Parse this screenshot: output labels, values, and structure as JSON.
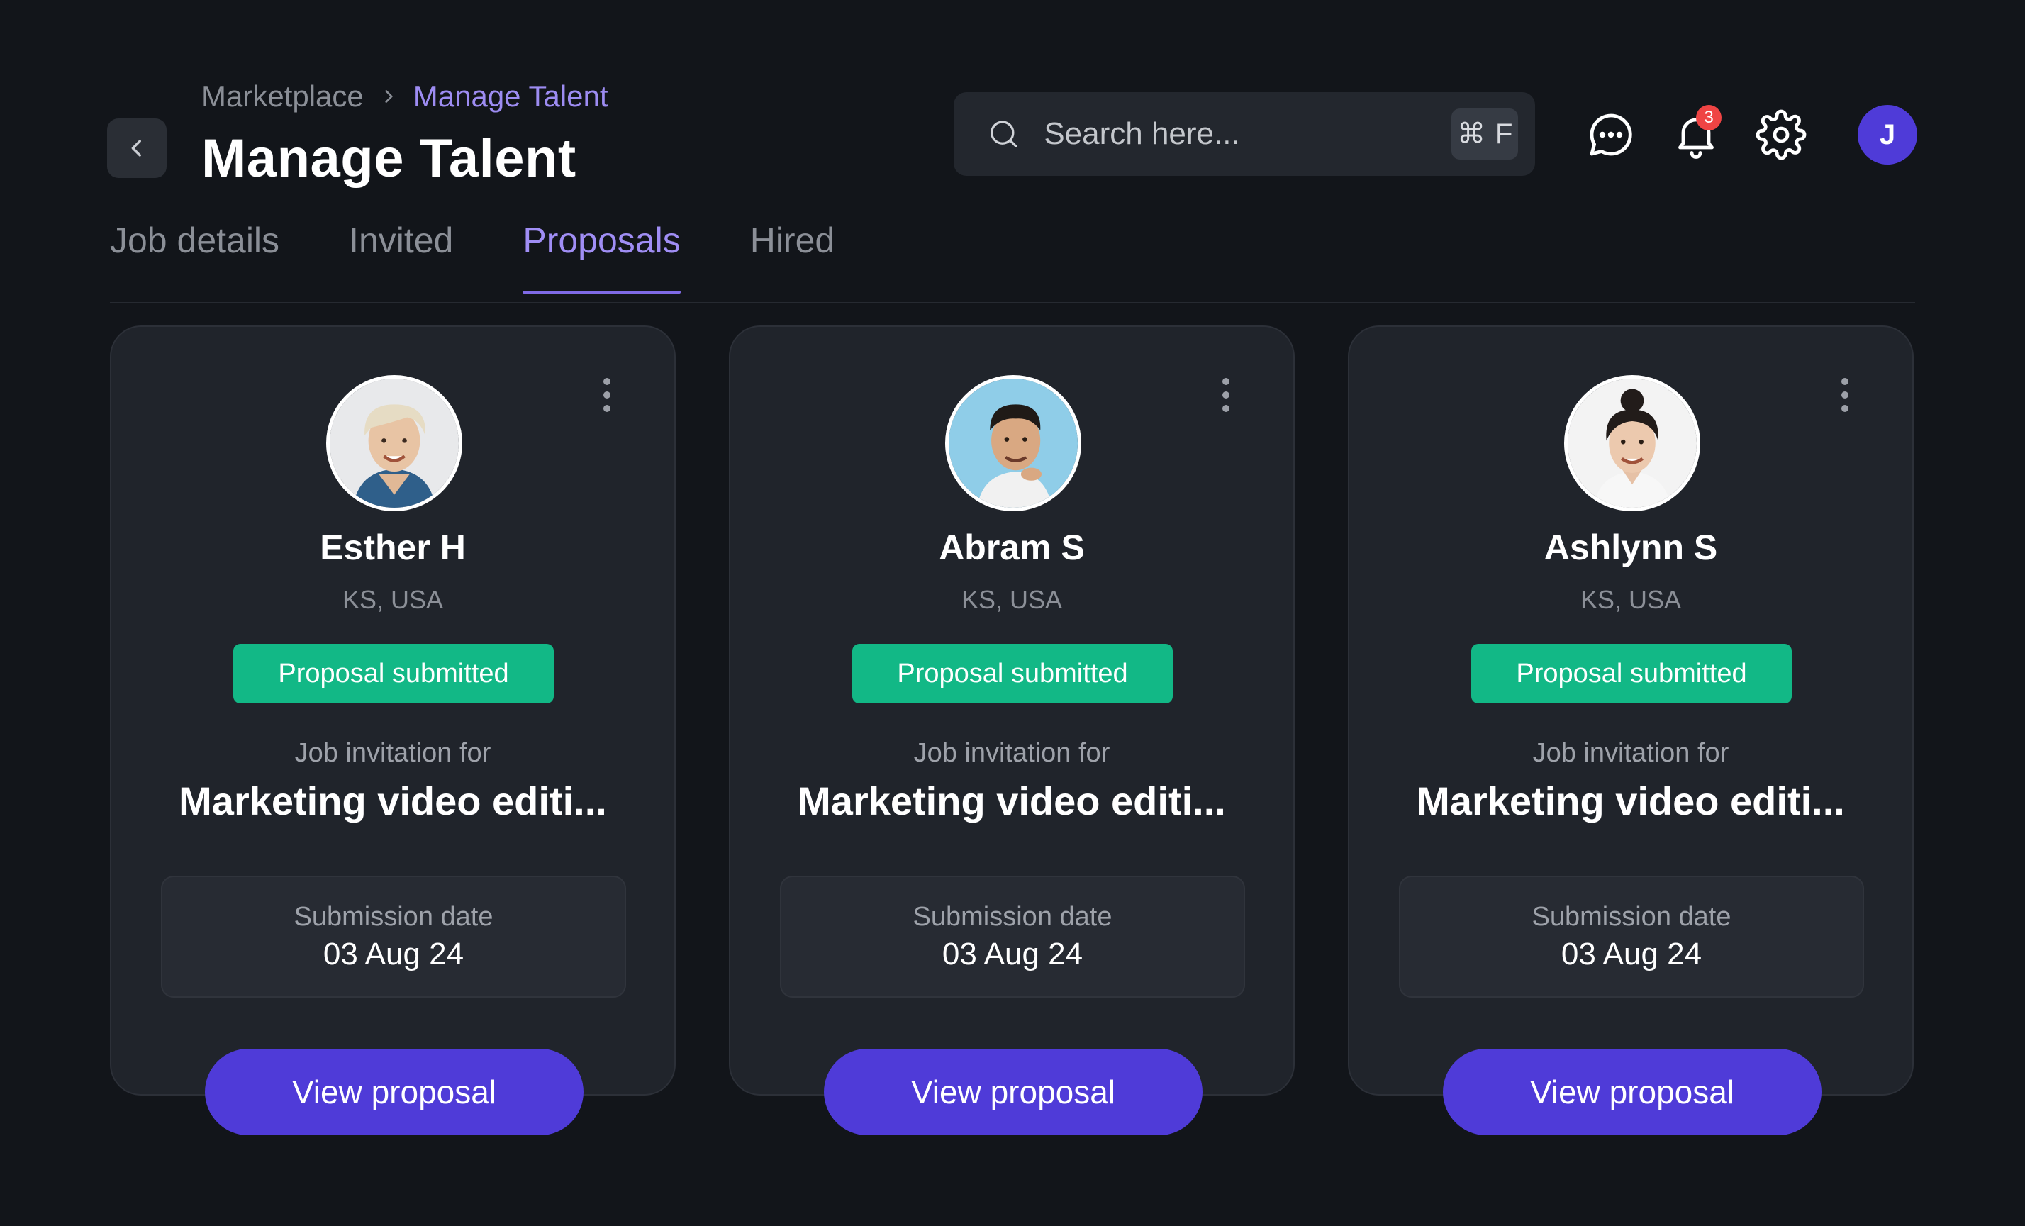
{
  "breadcrumb": {
    "parent": "Marketplace",
    "current": "Manage Talent"
  },
  "page_title": "Manage Talent",
  "search": {
    "placeholder": "Search here...",
    "shortcut_symbol": "⌘",
    "shortcut_key": "F"
  },
  "notifications": {
    "count": "3"
  },
  "user": {
    "initial": "J"
  },
  "tabs": [
    {
      "label": "Job details",
      "active": false
    },
    {
      "label": "Invited",
      "active": false
    },
    {
      "label": "Proposals",
      "active": true
    },
    {
      "label": "Hired",
      "active": false
    }
  ],
  "cards": [
    {
      "name": "Esther H",
      "location": "KS, USA",
      "status": "Proposal submitted",
      "invite_label": "Job invitation for",
      "job_title": "Marketing video editi...",
      "date_label": "Submission date",
      "date_value": "03 Aug 24",
      "button": "View proposal"
    },
    {
      "name": "Abram S",
      "location": "KS, USA",
      "status": "Proposal submitted",
      "invite_label": "Job invitation for",
      "job_title": "Marketing video editi...",
      "date_label": "Submission date",
      "date_value": "03 Aug 24",
      "button": "View proposal"
    },
    {
      "name": "Ashlynn S",
      "location": "KS, USA",
      "status": "Proposal submitted",
      "invite_label": "Job invitation for",
      "job_title": "Marketing video editi...",
      "date_label": "Submission date",
      "date_value": "03 Aug 24",
      "button": "View proposal"
    }
  ],
  "colors": {
    "background": "#12151a",
    "card": "#20242b",
    "accent": "#4f3bd8",
    "active_tab": "#a08ef5",
    "status_green": "#12b886",
    "badge_red": "#ef4444"
  },
  "icons": {
    "back": "chevron-left-icon",
    "breadcrumb_separator": "chevron-right-icon",
    "search": "search-icon",
    "messages": "chat-bubble-icon",
    "notifications": "bell-icon",
    "settings": "gear-icon",
    "card_menu": "more-vertical-icon"
  }
}
